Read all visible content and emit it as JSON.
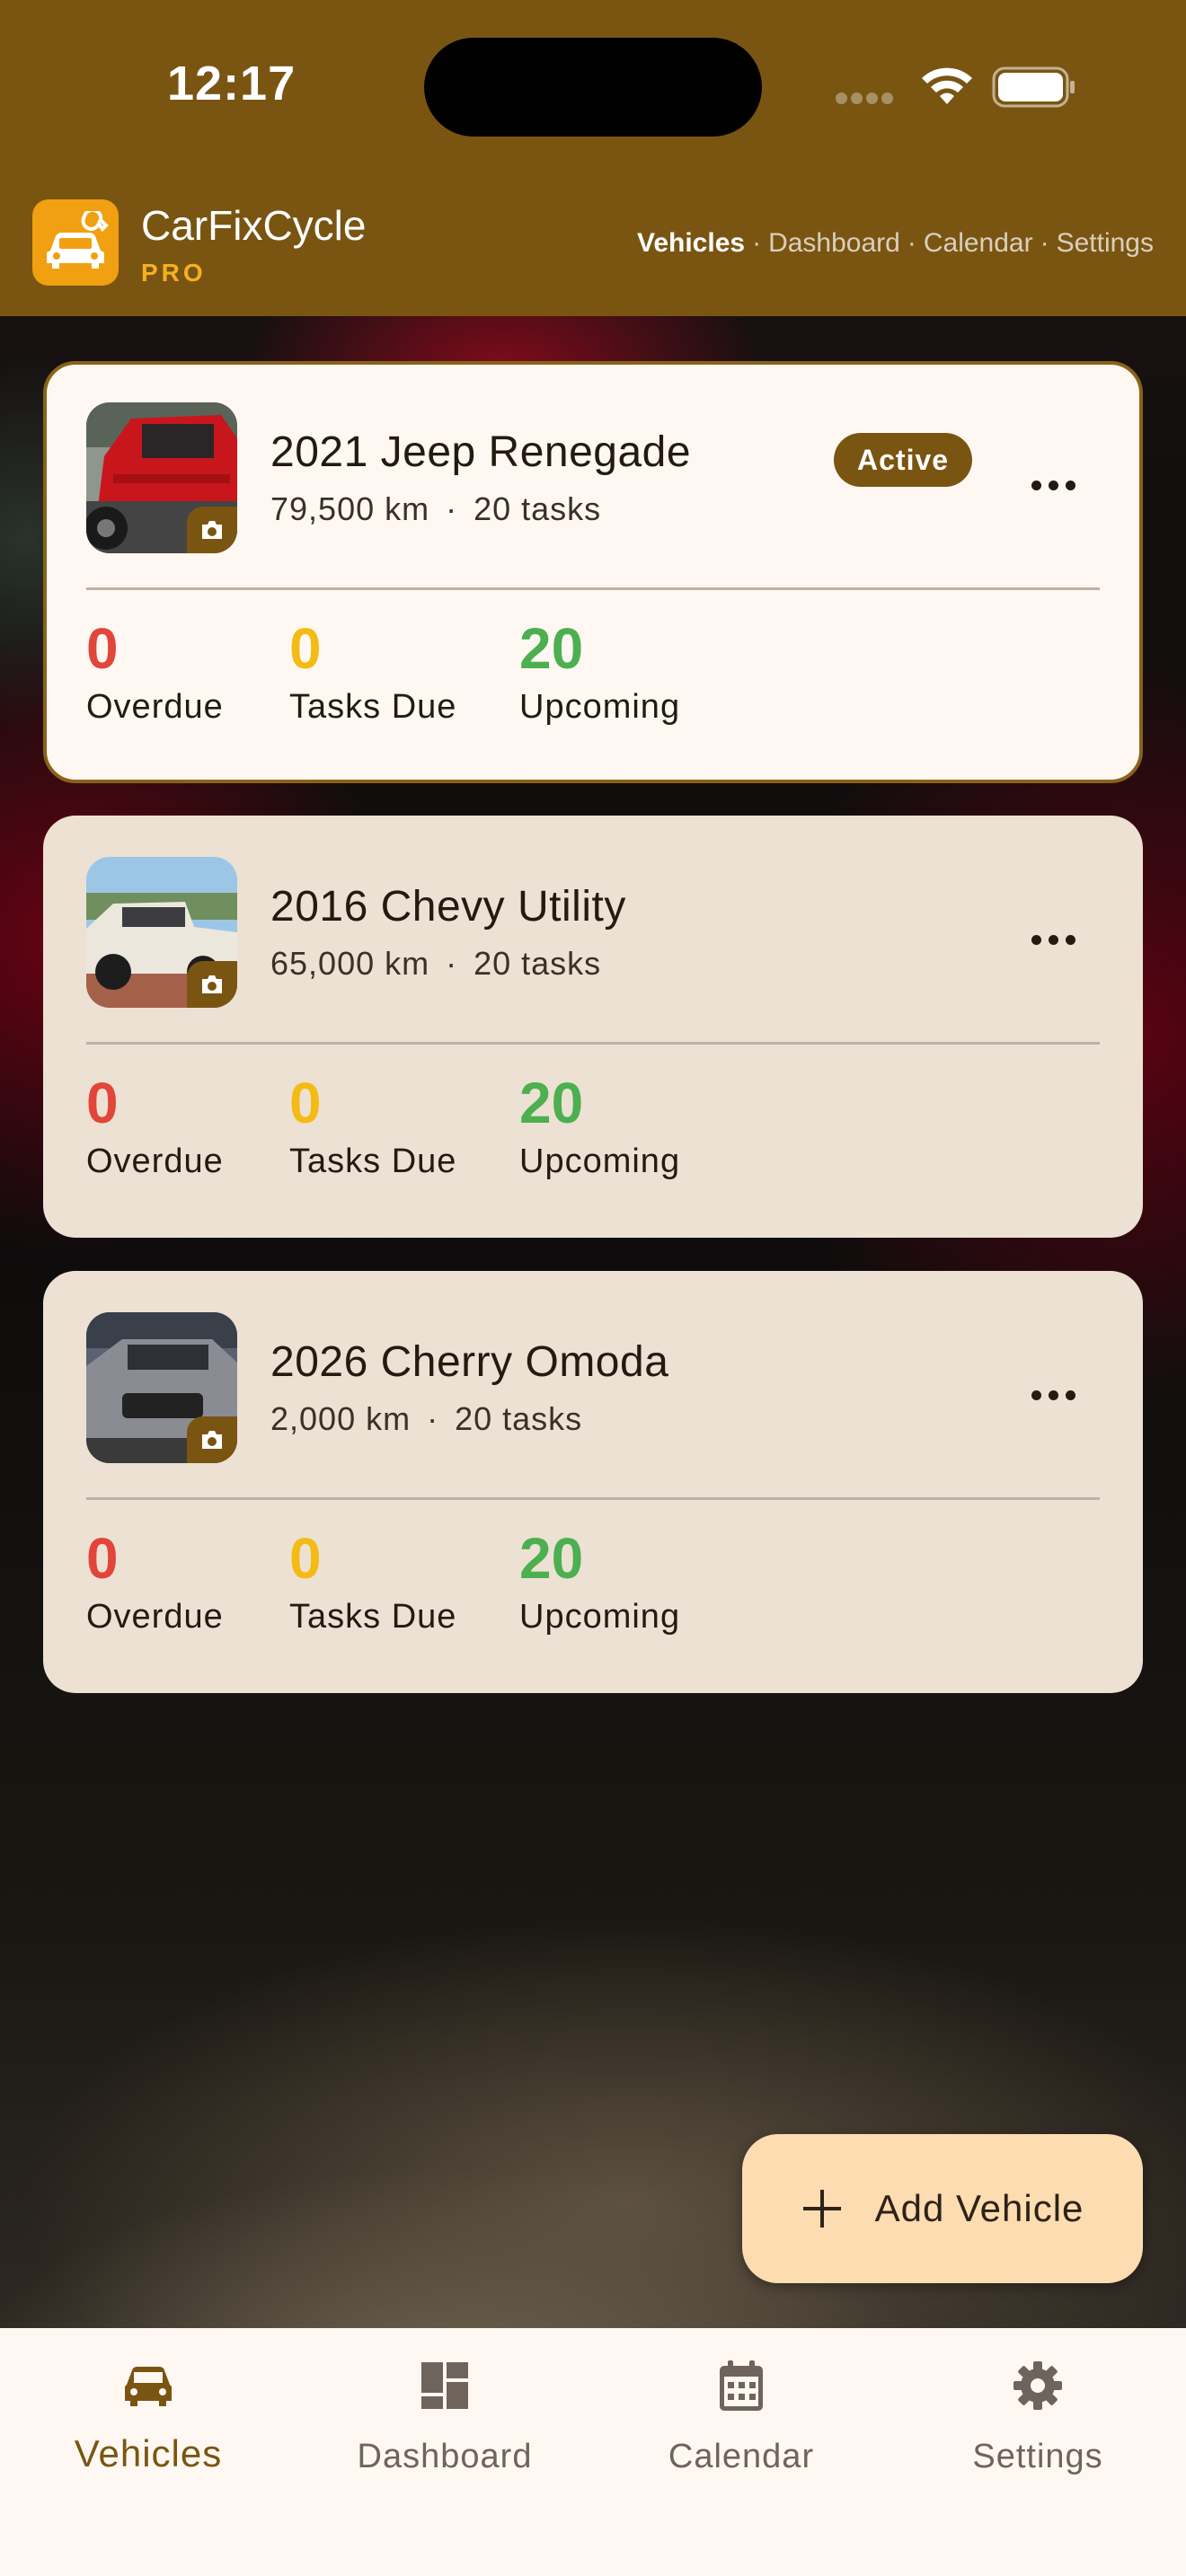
{
  "status_bar": {
    "time": "12:17"
  },
  "header": {
    "app_name": "CarFixCycle",
    "tier": "PRO",
    "nav": [
      {
        "label": "Vehicles",
        "active": true
      },
      {
        "label": "Dashboard",
        "active": false
      },
      {
        "label": "Calendar",
        "active": false
      },
      {
        "label": "Settings",
        "active": false
      }
    ],
    "nav_separator": "·"
  },
  "vehicles": [
    {
      "name": "2021 Jeep Renegade",
      "mileage": "79,500 km",
      "tasks": "20 tasks",
      "status_badge": "Active",
      "stats": {
        "overdue": "0",
        "due": "0",
        "upcoming": "20"
      },
      "photo_color": "#c8161c"
    },
    {
      "name": "2016 Chevy Utility",
      "mileage": "65,000 km",
      "tasks": "20 tasks",
      "stats": {
        "overdue": "0",
        "due": "0",
        "upcoming": "20"
      },
      "photo_color": "#e9e4d8"
    },
    {
      "name": "2026 Cherry Omoda",
      "mileage": "2,000 km",
      "tasks": "20 tasks",
      "stats": {
        "overdue": "0",
        "due": "0",
        "upcoming": "20"
      },
      "photo_color": "#7c7d83"
    }
  ],
  "stat_labels": {
    "overdue": "Overdue",
    "due": "Tasks Due",
    "upcoming": "Upcoming"
  },
  "meta_separator": "·",
  "fab": {
    "label": "Add Vehicle",
    "icon": "plus-icon"
  },
  "bottom_nav": [
    {
      "label": "Vehicles",
      "icon": "car-icon",
      "selected": true
    },
    {
      "label": "Dashboard",
      "icon": "dashboard-icon",
      "selected": false
    },
    {
      "label": "Calendar",
      "icon": "calendar-icon",
      "selected": false
    },
    {
      "label": "Settings",
      "icon": "gear-icon",
      "selected": false
    }
  ],
  "colors": {
    "brand": "#7a5512",
    "accent": "#f0a010",
    "overdue": "#e2453a",
    "due": "#f3bb14",
    "upcoming": "#4caf50"
  }
}
